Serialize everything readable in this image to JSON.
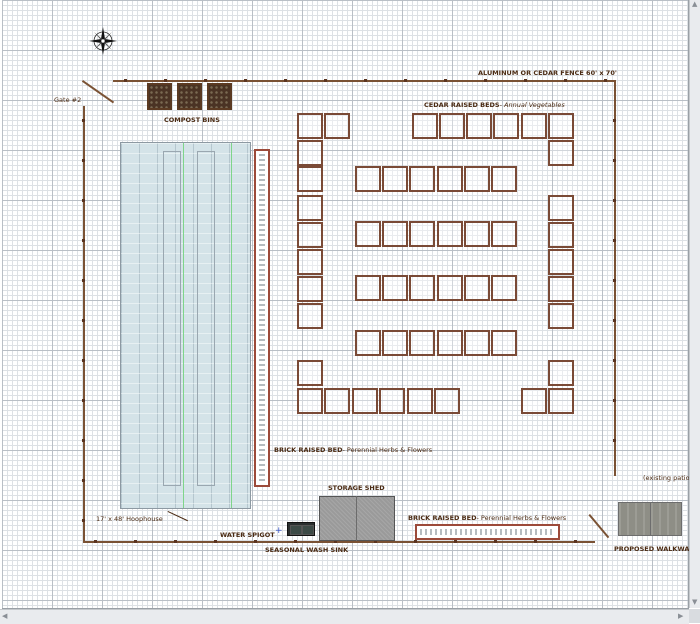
{
  "labels": {
    "fence": "ALUMINUM OR CEDAR FENCE 60' x 70'",
    "gate": "Gate #2",
    "compost": "COMPOST BINS",
    "cedar_beds_bold": "CEDAR RAISED BEDS",
    "cedar_beds_italic": "- Annual Vegetables",
    "brick_side_bold": "BRICK RAISED BED",
    "brick_side_rest": "- Perennial Herbs & Flowers",
    "brick_bottom_bold": "BRICK RAISED BED",
    "brick_bottom_rest": "- Perennial Herbs & Flowers",
    "hoophouse": "17' x 48' Hoophouse",
    "storage_shed": "STORAGE SHED",
    "water_spigot": "WATER SPIGOT",
    "wash_sink": "SEASONAL WASH SINK",
    "existing_patio": "(existing patio)",
    "proposed_walkway": "PROPOSED WALKWAY"
  },
  "icons": {
    "compass": "compass-rose-icon",
    "spigot": "plus-icon",
    "scroll_up": "scroll-up-arrow-icon",
    "scroll_down": "scroll-down-arrow-icon",
    "scroll_left": "scroll-left-arrow-icon",
    "scroll_right": "scroll-right-arrow-icon"
  },
  "colors": {
    "fence": "#7a5234",
    "cedar_bed": "#7a4a36",
    "brick_bed": "#9c4a3a",
    "label_text": "#4a2a12",
    "grid": "#b9bfc6"
  }
}
